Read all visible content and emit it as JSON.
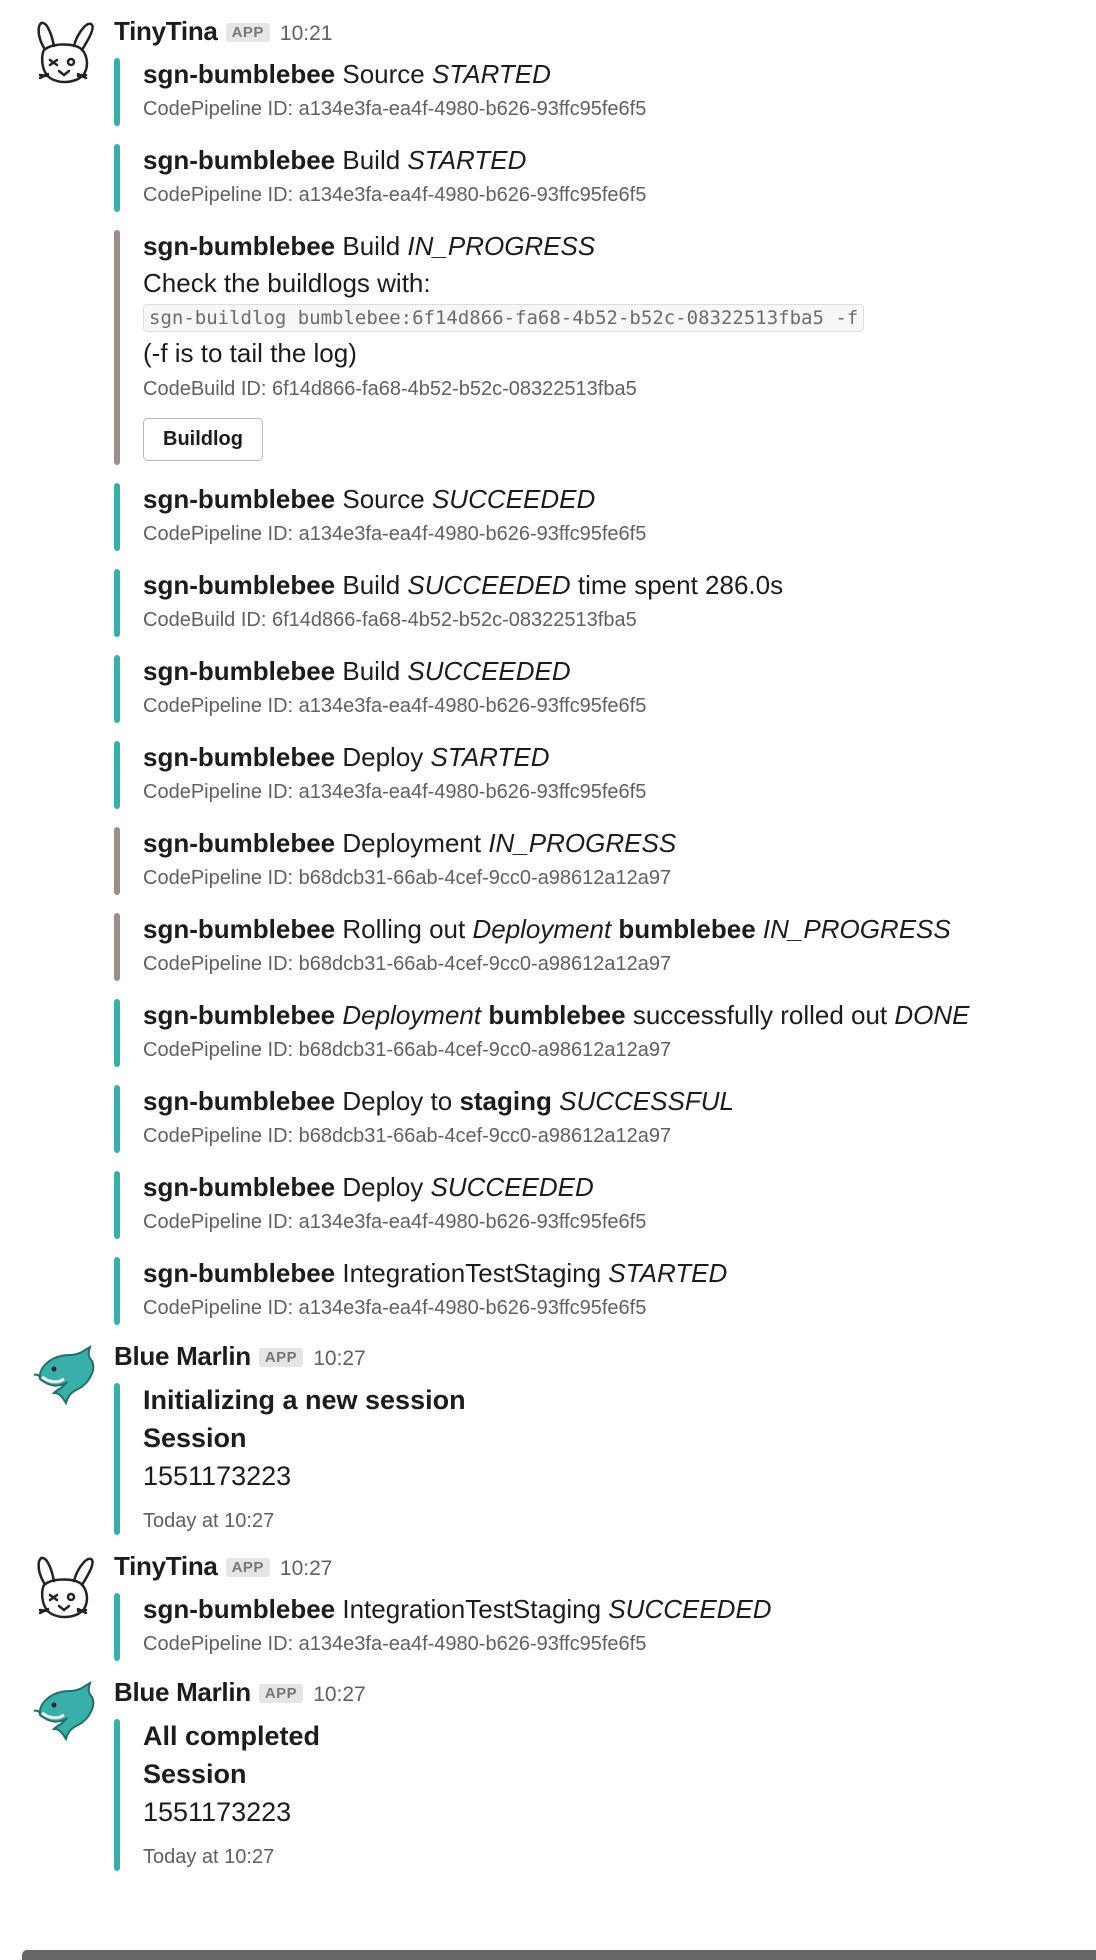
{
  "colors": {
    "teal": "#3aafa9",
    "brown": "#9d8c87"
  },
  "messages": [
    {
      "sender": "TinyTina",
      "badge": "APP",
      "time": "10:21",
      "avatar": "rabbit-avatar-icon",
      "attachments": [
        {
          "color": "#3aafa9",
          "parts": [
            {
              "t": "sgn-bumblebee",
              "s": "b"
            },
            {
              "t": " Source "
            },
            {
              "t": "STARTED",
              "s": "i"
            }
          ],
          "footer": "CodePipeline ID: a134e3fa-ea4f-4980-b626-93ffc95fe6f5"
        },
        {
          "color": "#3aafa9",
          "parts": [
            {
              "t": "sgn-bumblebee",
              "s": "b"
            },
            {
              "t": " Build "
            },
            {
              "t": "STARTED",
              "s": "i"
            }
          ],
          "footer": "CodePipeline ID: a134e3fa-ea4f-4980-b626-93ffc95fe6f5"
        },
        {
          "color": "#9d8c87",
          "parts": [
            {
              "t": "sgn-bumblebee",
              "s": "b"
            },
            {
              "t": " Build "
            },
            {
              "t": "IN_PROGRESS",
              "s": "i"
            }
          ],
          "lines": [
            "Check the buildlogs with:"
          ],
          "code": "sgn-buildlog bumblebee:6f14d866-fa68-4b52-b52c-08322513fba5 -f",
          "after": [
            "(-f is to tail the log)"
          ],
          "footer": "CodeBuild ID: 6f14d866-fa68-4b52-b52c-08322513fba5",
          "button": "Buildlog"
        },
        {
          "color": "#3aafa9",
          "parts": [
            {
              "t": "sgn-bumblebee",
              "s": "b"
            },
            {
              "t": " Source "
            },
            {
              "t": "SUCCEEDED",
              "s": "i"
            }
          ],
          "footer": "CodePipeline ID: a134e3fa-ea4f-4980-b626-93ffc95fe6f5"
        },
        {
          "color": "#3aafa9",
          "parts": [
            {
              "t": "sgn-bumblebee",
              "s": "b"
            },
            {
              "t": " Build "
            },
            {
              "t": "SUCCEEDED",
              "s": "i"
            },
            {
              "t": " time spent 286.0s"
            }
          ],
          "footer": "CodeBuild ID: 6f14d866-fa68-4b52-b52c-08322513fba5"
        },
        {
          "color": "#3aafa9",
          "parts": [
            {
              "t": "sgn-bumblebee",
              "s": "b"
            },
            {
              "t": " Build "
            },
            {
              "t": "SUCCEEDED",
              "s": "i"
            }
          ],
          "footer": "CodePipeline ID: a134e3fa-ea4f-4980-b626-93ffc95fe6f5"
        },
        {
          "color": "#3aafa9",
          "parts": [
            {
              "t": "sgn-bumblebee",
              "s": "b"
            },
            {
              "t": " Deploy "
            },
            {
              "t": "STARTED",
              "s": "i"
            }
          ],
          "footer": "CodePipeline ID: a134e3fa-ea4f-4980-b626-93ffc95fe6f5"
        },
        {
          "color": "#9d8c87",
          "parts": [
            {
              "t": "sgn-bumblebee",
              "s": "b"
            },
            {
              "t": " Deployment "
            },
            {
              "t": "IN_PROGRESS",
              "s": "i"
            }
          ],
          "footer": "CodePipeline ID: b68dcb31-66ab-4cef-9cc0-a98612a12a97"
        },
        {
          "color": "#9d8c87",
          "parts": [
            {
              "t": "sgn-bumblebee",
              "s": "b"
            },
            {
              "t": " Rolling out "
            },
            {
              "t": "Deployment",
              "s": "i"
            },
            {
              "t": " "
            },
            {
              "t": "bumblebee",
              "s": "b"
            },
            {
              "t": " "
            },
            {
              "t": "IN_PROGRESS",
              "s": "i"
            }
          ],
          "footer": "CodePipeline ID: b68dcb31-66ab-4cef-9cc0-a98612a12a97"
        },
        {
          "color": "#3aafa9",
          "parts": [
            {
              "t": "sgn-bumblebee",
              "s": "b"
            },
            {
              "t": " "
            },
            {
              "t": "Deployment",
              "s": "i"
            },
            {
              "t": " "
            },
            {
              "t": "bumblebee",
              "s": "b"
            },
            {
              "t": " successfully rolled out "
            },
            {
              "t": "DONE",
              "s": "i"
            }
          ],
          "footer": "CodePipeline ID: b68dcb31-66ab-4cef-9cc0-a98612a12a97"
        },
        {
          "color": "#3aafa9",
          "parts": [
            {
              "t": "sgn-bumblebee",
              "s": "b"
            },
            {
              "t": " Deploy to "
            },
            {
              "t": "staging",
              "s": "b"
            },
            {
              "t": " "
            },
            {
              "t": "SUCCESSFUL",
              "s": "i"
            }
          ],
          "footer": "CodePipeline ID: b68dcb31-66ab-4cef-9cc0-a98612a12a97"
        },
        {
          "color": "#3aafa9",
          "parts": [
            {
              "t": "sgn-bumblebee",
              "s": "b"
            },
            {
              "t": " Deploy "
            },
            {
              "t": "SUCCEEDED",
              "s": "i"
            }
          ],
          "footer": "CodePipeline ID: a134e3fa-ea4f-4980-b626-93ffc95fe6f5"
        },
        {
          "color": "#3aafa9",
          "parts": [
            {
              "t": "sgn-bumblebee",
              "s": "b"
            },
            {
              "t": " IntegrationTestStaging "
            },
            {
              "t": "STARTED",
              "s": "i"
            }
          ],
          "footer": "CodePipeline ID: a134e3fa-ea4f-4980-b626-93ffc95fe6f5"
        }
      ]
    },
    {
      "sender": "Blue Marlin",
      "badge": "APP",
      "time": "10:27",
      "avatar": "dolphin-avatar-icon",
      "session": {
        "color": "#3aafa9",
        "heading": "Initializing a new session",
        "label": "Session",
        "value": "1551173223",
        "timestamp": "Today at 10:27"
      }
    },
    {
      "sender": "TinyTina",
      "badge": "APP",
      "time": "10:27",
      "avatar": "rabbit-avatar-icon",
      "attachments": [
        {
          "color": "#3aafa9",
          "parts": [
            {
              "t": "sgn-bumblebee",
              "s": "b"
            },
            {
              "t": " IntegrationTestStaging "
            },
            {
              "t": "SUCCEEDED",
              "s": "i"
            }
          ],
          "footer": "CodePipeline ID: a134e3fa-ea4f-4980-b626-93ffc95fe6f5"
        }
      ]
    },
    {
      "sender": "Blue Marlin",
      "badge": "APP",
      "time": "10:27",
      "avatar": "dolphin-avatar-icon",
      "session": {
        "color": "#3aafa9",
        "heading": "All completed",
        "label": "Session",
        "value": "1551173223",
        "timestamp": "Today at 10:27"
      }
    }
  ]
}
